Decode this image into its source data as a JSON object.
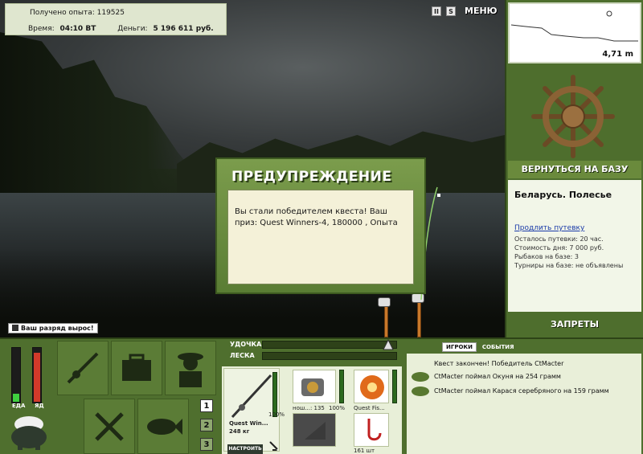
{
  "hud": {
    "experience_label": "Получено опыта:",
    "experience_value": "119525",
    "time_label": "Время:",
    "time_value": "04:10 ВТ",
    "money_label": "Деньги:",
    "money_value": "5 196 611 руб.",
    "pause_label": "II",
    "sound_label": "S",
    "menu_label": "МЕНЮ"
  },
  "depth": {
    "value": "4,71 m"
  },
  "base": {
    "return_label": "ВЕРНУТЬСЯ НА БАЗУ",
    "location": "Беларусь. Полесье",
    "extend_link": "Продлить путевку",
    "lines": [
      "Осталось путевки: 20 час.",
      "Стоимость дня: 7 000 руб.",
      "Рыбаков на базе: 3",
      "Турниры на базе: не объявлены"
    ],
    "bans_label": "ЗАПРЕТЫ"
  },
  "dialog": {
    "title": "ПРЕДУПРЕЖДЕНИЕ",
    "message": "Вы стали победителем квеста! Ваш приз: Quest Winners-4, 180000 , Опыта"
  },
  "toast": {
    "text": "Ваш разряд вырос!"
  },
  "status": {
    "food_label": "ЕДА",
    "fatigue_label": "ЯД",
    "food_level": 0.15,
    "fatigue_level": 0.92
  },
  "pages": [
    "1",
    "2",
    "3"
  ],
  "gear": {
    "rod_label": "УДОЧКА",
    "line_label": "ЛЕСКА",
    "rod_name": "Quest Win...",
    "rod_weight": "248 кг",
    "rod_pct": "100%",
    "reel_name": "нош...: 135",
    "reel_pct": "100%",
    "line_name": "Quest Fis...",
    "hook_qty": "161 шт",
    "tune_label": "НАСТРОИТЬ"
  },
  "events": {
    "tab_players": "ИГРОКИ",
    "tab_events": "СОБЫТИЯ",
    "messages": [
      "Квест закончен! Победитель CtMacter",
      "CtMacter поймал Окуня на 254 грамм",
      "CtMacter поймал Карася серебряного на 159 грамм"
    ]
  },
  "colors": {
    "panel_green": "#4f6f2e",
    "accent_red": "#d23a2a",
    "accent_green": "#3fcf3f"
  }
}
